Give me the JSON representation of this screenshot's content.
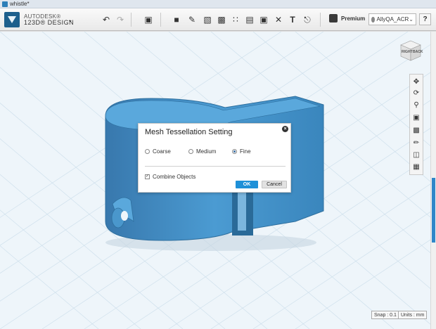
{
  "window": {
    "title": "whistle*"
  },
  "brand": {
    "line1": "AUTODESK®",
    "line2": "123D® DESIGN"
  },
  "toolbar": {
    "icons": [
      "undo-icon",
      "redo-icon",
      "import-icon",
      "primitives-icon",
      "sketch-icon",
      "construct-icon",
      "modify-icon",
      "pattern-icon",
      "grouping-icon",
      "combine-icon",
      "measure-icon",
      "text-icon",
      "snap-icon",
      "material-icon"
    ]
  },
  "account": {
    "premium_label": "Premium",
    "user": "AllyQA_ACR",
    "help": "?"
  },
  "viewcube": {
    "right": "RIGHT",
    "back": "BACK"
  },
  "status": {
    "snap": "Snap : 0.1",
    "units": "Units : mm"
  },
  "dialog": {
    "title": "Mesh Tessellation Setting",
    "options": [
      {
        "label": "Coarse",
        "selected": false
      },
      {
        "label": "Medium",
        "selected": false
      },
      {
        "label": "Fine",
        "selected": true
      }
    ],
    "combine_label": "Combine Objects",
    "combine_checked": true,
    "ok_label": "OK",
    "cancel_label": "Cancel"
  },
  "colors": {
    "accent": "#1e90d8",
    "model": "#3f8fc9",
    "grid_bg": "#eef5fa"
  }
}
